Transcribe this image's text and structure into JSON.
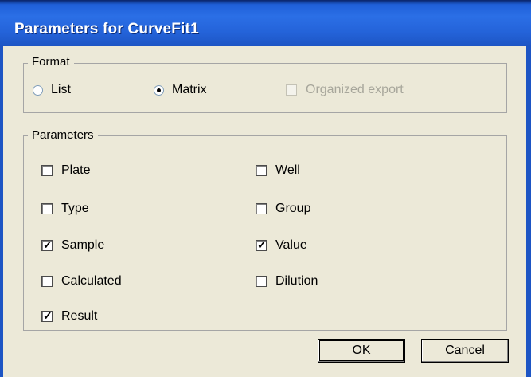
{
  "window": {
    "title": "Parameters for CurveFit1"
  },
  "format": {
    "label": "Format",
    "options": [
      {
        "label": "List",
        "selected": false
      },
      {
        "label": "Matrix",
        "selected": true
      }
    ],
    "organized_export": {
      "label": "Organized export",
      "checked": false,
      "enabled": false
    }
  },
  "parameters": {
    "label": "Parameters",
    "left": [
      {
        "label": "Plate",
        "checked": false
      },
      {
        "label": "Type",
        "checked": false
      },
      {
        "label": "Sample",
        "checked": true
      },
      {
        "label": "Calculated",
        "checked": false
      },
      {
        "label": "Result",
        "checked": true
      }
    ],
    "right": [
      {
        "label": "Well",
        "checked": false
      },
      {
        "label": "Group",
        "checked": false
      },
      {
        "label": "Value",
        "checked": true
      },
      {
        "label": "Dilution",
        "checked": false
      }
    ]
  },
  "buttons": {
    "ok": "OK",
    "cancel": "Cancel"
  },
  "colors": {
    "titlebar": "#2463d9",
    "dialog_bg": "#ece9d8"
  }
}
